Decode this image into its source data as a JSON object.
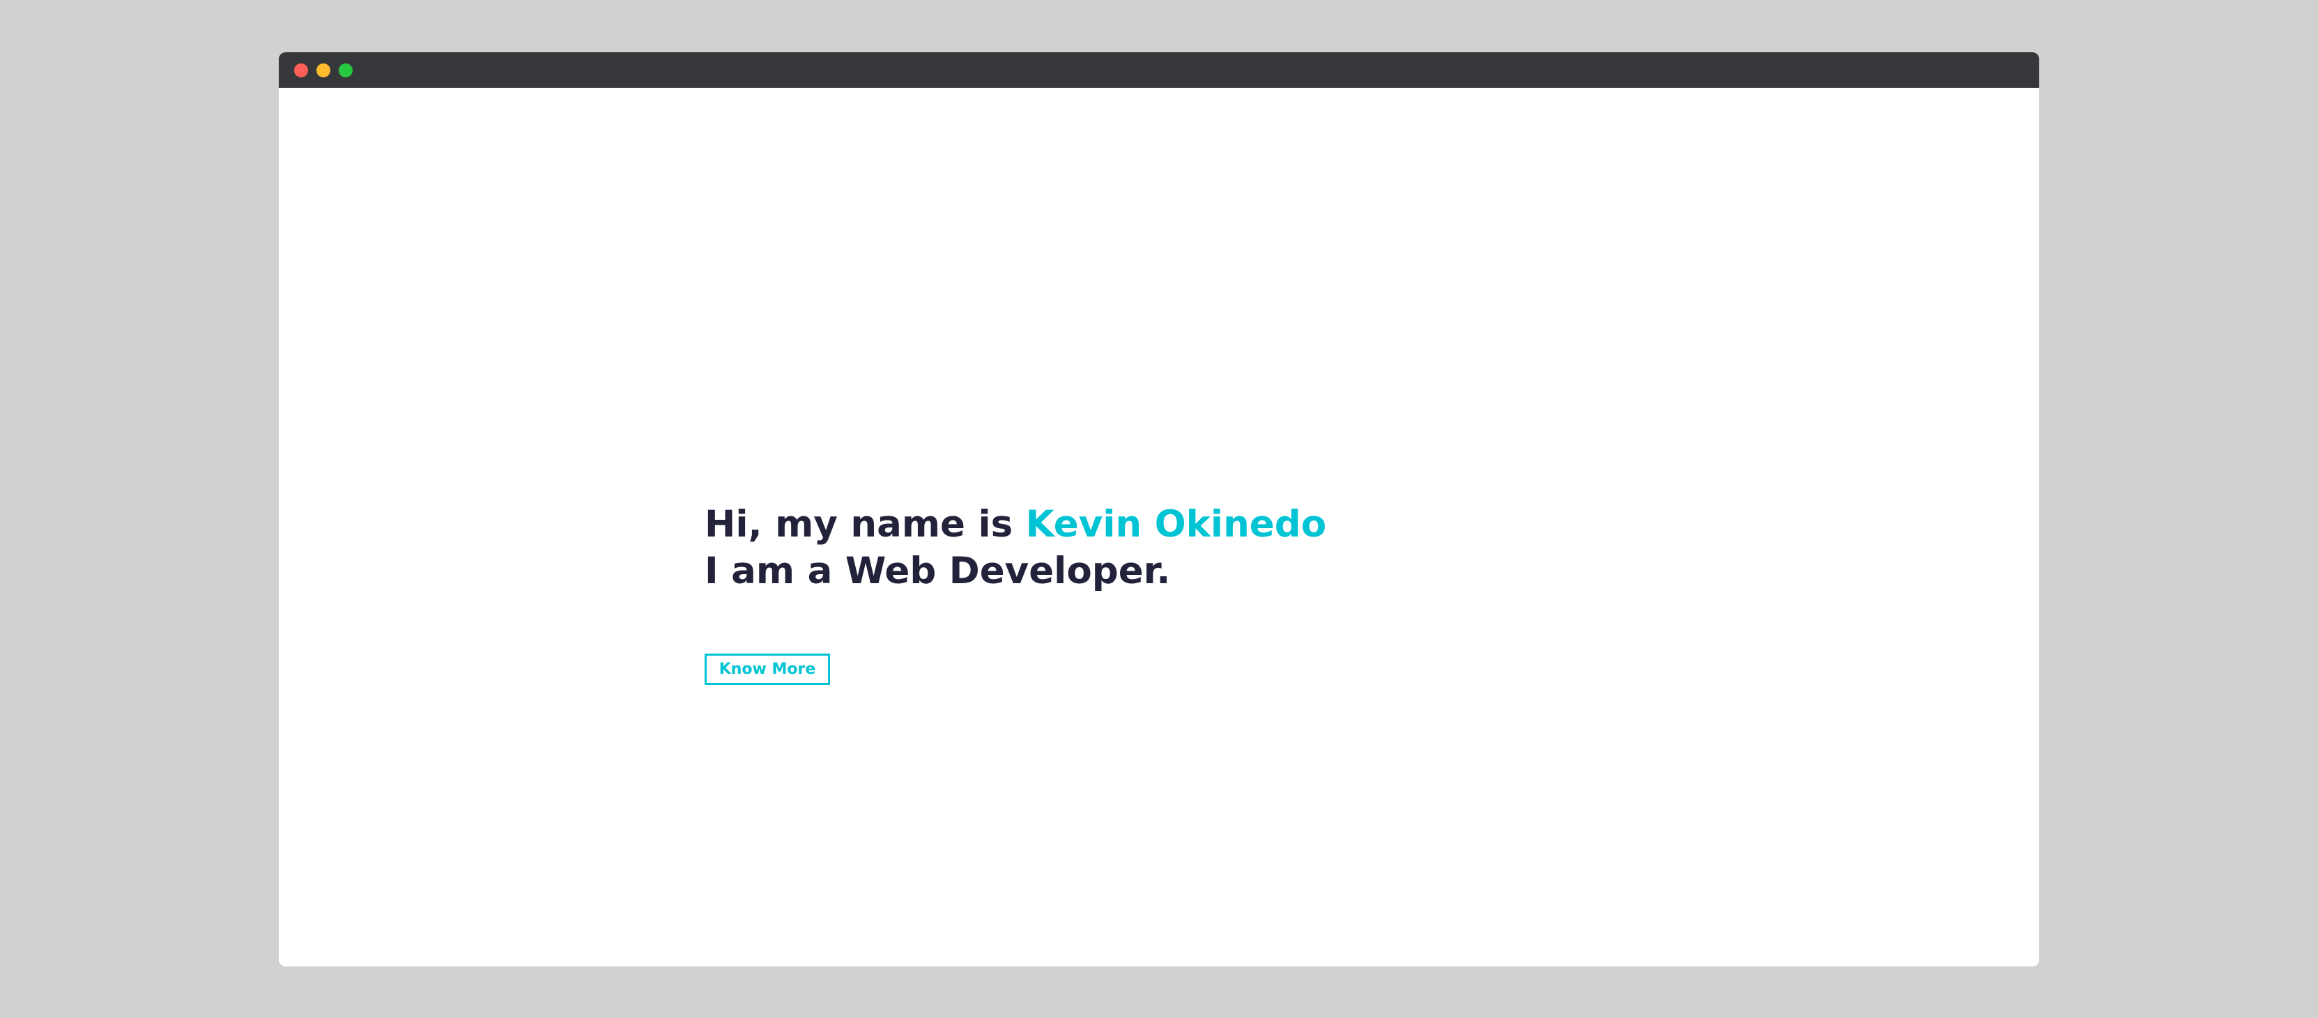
{
  "window": {
    "controls": {
      "close_color": "#ff5f57",
      "minimize_color": "#febc2e",
      "maximize_color": "#28c840"
    }
  },
  "hero": {
    "line1_prefix": "Hi, my name is ",
    "name": "Kevin Okinedo",
    "line2": "I am a Web Developer.",
    "cta_label": "Know More"
  },
  "colors": {
    "accent": "#00c4d4",
    "text": "#22223b",
    "titlebar": "#36373a",
    "background": "#d1d1d1"
  }
}
